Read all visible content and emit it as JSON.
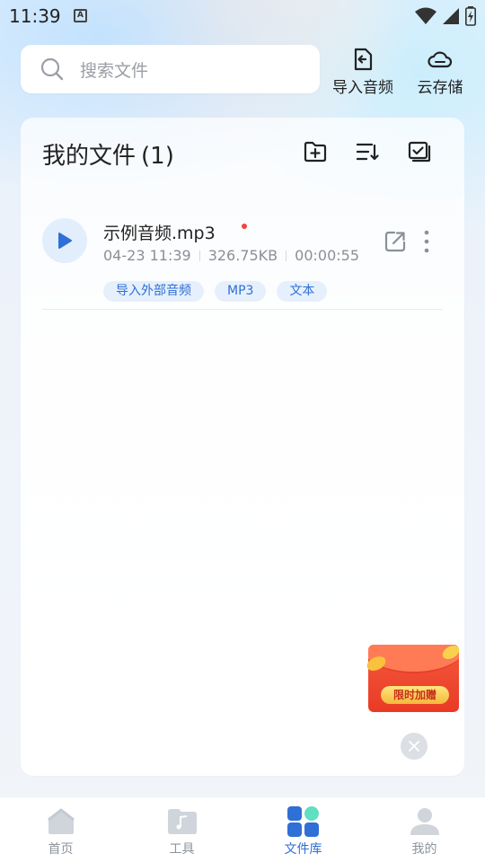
{
  "status_bar": {
    "time": "11:39",
    "notification_letter": "A"
  },
  "search": {
    "placeholder": "搜索文件"
  },
  "header_actions": {
    "import_audio": "导入音频",
    "cloud_storage": "云存储"
  },
  "card": {
    "title": "我的文件",
    "count": "(1)",
    "files": [
      {
        "name": "示例音频.mp3",
        "date": "04-23 11:39",
        "size": "326.75KB",
        "duration": "00:00:55",
        "tags": [
          "导入外部音频",
          "MP3",
          "文本"
        ]
      }
    ]
  },
  "promo": {
    "label": "限时加赠"
  },
  "bottom_nav": [
    {
      "label": "首页"
    },
    {
      "label": "工具"
    },
    {
      "label": "文件库"
    },
    {
      "label": "我的"
    }
  ],
  "colors": {
    "accent": "#2f6fd6",
    "nav_inactive": "#d0d4db",
    "active_secondary": "#5fe0c0"
  }
}
